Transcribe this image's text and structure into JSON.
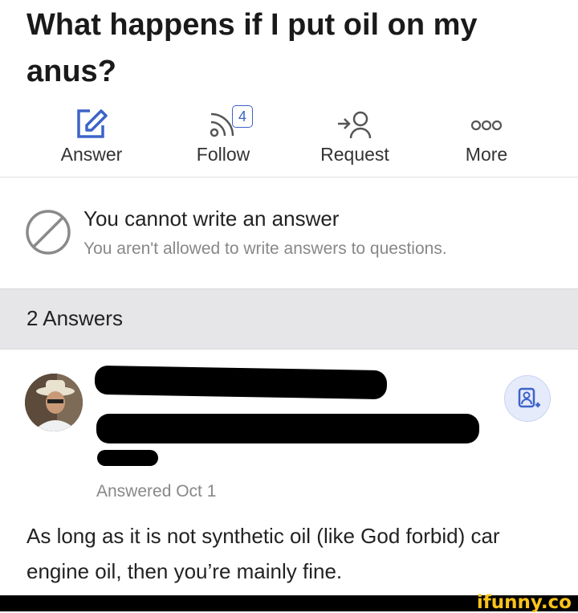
{
  "question": {
    "title": "What happens if I put oil on my anus?"
  },
  "actions": [
    {
      "label": "Answer",
      "icon": "pencil-icon"
    },
    {
      "label": "Follow",
      "icon": "rss-icon",
      "badge": "4"
    },
    {
      "label": "Request",
      "icon": "request-user-icon"
    },
    {
      "label": "More",
      "icon": "more-dots-icon"
    }
  ],
  "notice": {
    "heading": "You cannot write an answer",
    "subtext": "You aren't allowed to write answers to questions.",
    "icon": "ban-icon"
  },
  "answers_header": {
    "label": "2 Answers"
  },
  "answer": {
    "answered_date": "Answered Oct 1",
    "text": "As long as it is not synthetic oil (like God forbid) car engine oil, then you’re mainly fine.",
    "follow_icon": "follow-user-icon"
  },
  "watermark": {
    "text": "ifunny.co",
    "color": "#f8c31a"
  },
  "colors": {
    "accent": "#3d63c9",
    "band": "#e6e6e8"
  }
}
